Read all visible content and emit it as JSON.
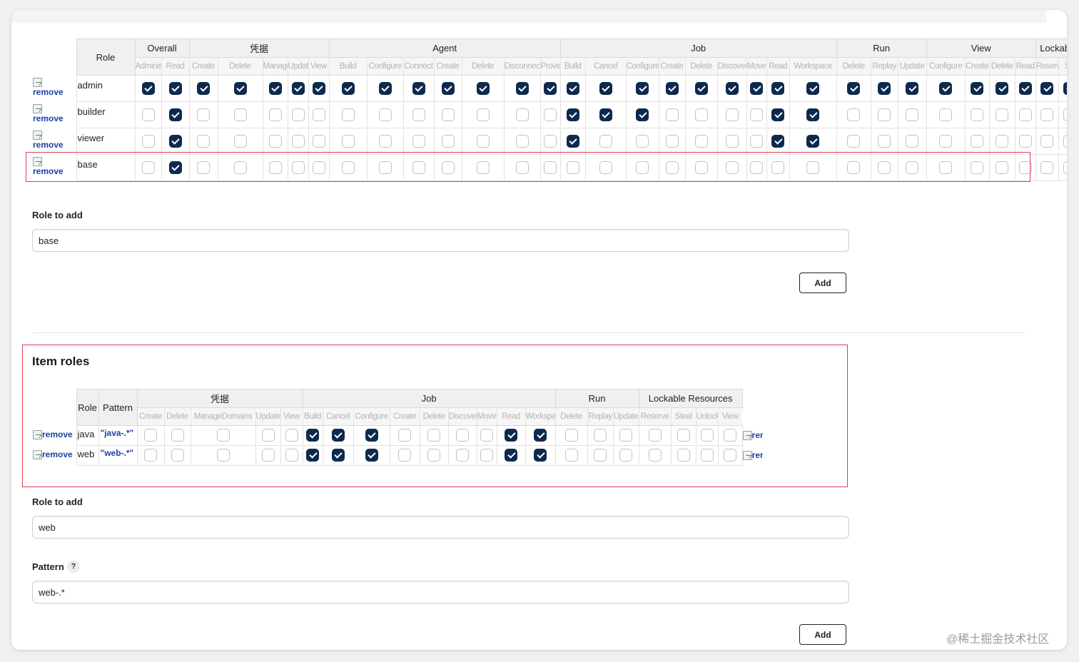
{
  "global_roles": {
    "role_header": "Role",
    "groups": [
      {
        "name": "Overall",
        "perms": [
          "Administer",
          "Read"
        ]
      },
      {
        "name": "凭据",
        "perms": [
          "Create",
          "Delete",
          "ManageDomains",
          "Update",
          "View"
        ]
      },
      {
        "name": "Agent",
        "perms": [
          "Build",
          "Configure",
          "Connect",
          "Create",
          "Delete",
          "Disconnect",
          "Provision"
        ]
      },
      {
        "name": "Job",
        "perms": [
          "Build",
          "Cancel",
          "Configure",
          "Create",
          "Delete",
          "Discover",
          "Move",
          "Read",
          "Workspace"
        ]
      },
      {
        "name": "Run",
        "perms": [
          "Delete",
          "Replay",
          "Update"
        ]
      },
      {
        "name": "View",
        "perms": [
          "Configure",
          "Create",
          "Delete",
          "Read"
        ]
      },
      {
        "name": "Lockable",
        "perms": [
          "Reserve",
          "Ste"
        ]
      }
    ],
    "rows": [
      {
        "role": "admin",
        "remove": "remove",
        "checks": [
          1,
          1,
          1,
          1,
          1,
          1,
          1,
          1,
          1,
          1,
          1,
          1,
          1,
          1,
          1,
          1,
          1,
          1,
          1,
          1,
          1,
          1,
          1,
          1,
          1,
          1,
          1,
          1,
          1,
          1,
          1,
          1
        ]
      },
      {
        "role": "builder",
        "remove": "remove",
        "checks": [
          0,
          1,
          0,
          0,
          0,
          0,
          0,
          0,
          0,
          0,
          0,
          0,
          0,
          0,
          1,
          1,
          1,
          0,
          0,
          0,
          0,
          1,
          1,
          0,
          0,
          0,
          0,
          0,
          0,
          0,
          0,
          0
        ]
      },
      {
        "role": "viewer",
        "remove": "remove",
        "checks": [
          0,
          1,
          0,
          0,
          0,
          0,
          0,
          0,
          0,
          0,
          0,
          0,
          0,
          0,
          1,
          0,
          0,
          0,
          0,
          0,
          0,
          1,
          1,
          0,
          0,
          0,
          0,
          0,
          0,
          0,
          0,
          0
        ]
      },
      {
        "role": "base",
        "remove": "remove",
        "checks": [
          0,
          1,
          0,
          0,
          0,
          0,
          0,
          0,
          0,
          0,
          0,
          0,
          0,
          0,
          0,
          0,
          0,
          0,
          0,
          0,
          0,
          0,
          0,
          0,
          0,
          0,
          0,
          0,
          0,
          0,
          0,
          0
        ]
      }
    ]
  },
  "global_add": {
    "label": "Role to add",
    "value": "base",
    "button": "Add"
  },
  "item_roles": {
    "title": "Item roles",
    "role_header": "Role",
    "pattern_header": "Pattern",
    "groups": [
      {
        "name": "凭据",
        "perms": [
          "Create",
          "Delete",
          "ManageDomains",
          "Update",
          "View"
        ]
      },
      {
        "name": "Job",
        "perms": [
          "Build",
          "Cancel",
          "Configure",
          "Create",
          "Delete",
          "Discover",
          "Move",
          "Read",
          "Workspace"
        ]
      },
      {
        "name": "Run",
        "perms": [
          "Delete",
          "Replay",
          "Update"
        ]
      },
      {
        "name": "Lockable Resources",
        "perms": [
          "Reserve",
          "Steal",
          "Unlock",
          "View"
        ]
      }
    ],
    "rows": [
      {
        "role": "java",
        "pattern": "\"java-.*\"",
        "remove": "remove",
        "checks": [
          0,
          0,
          0,
          0,
          0,
          1,
          1,
          1,
          0,
          0,
          0,
          0,
          1,
          1,
          0,
          0,
          0,
          0,
          0,
          0,
          0
        ]
      },
      {
        "role": "web",
        "pattern": "\"web-.*\"",
        "remove": "remove",
        "checks": [
          0,
          0,
          0,
          0,
          0,
          1,
          1,
          1,
          0,
          0,
          0,
          0,
          1,
          1,
          0,
          0,
          0,
          0,
          0,
          0,
          0
        ]
      }
    ]
  },
  "item_add": {
    "label": "Role to add",
    "value": "web",
    "pattern_label": "Pattern",
    "help": "?",
    "pattern_value": "web-.*",
    "button": "Add"
  },
  "watermark": "@稀土掘金技术社区",
  "colors": {
    "checked": "#0d2a4e",
    "highlight": "#e03c55",
    "link": "#1c3fa8"
  }
}
